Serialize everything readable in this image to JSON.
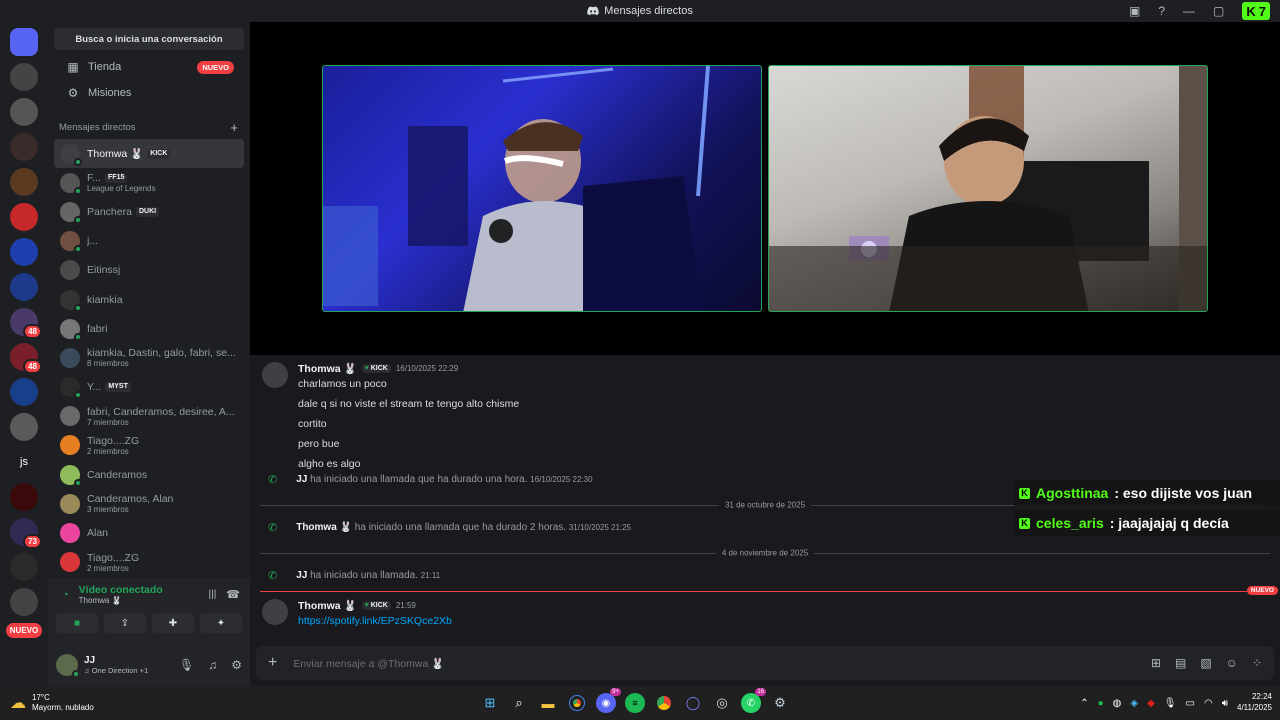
{
  "window": {
    "title": "Mensajes directos",
    "kick_badge": "7"
  },
  "rail": {
    "servers": [
      {
        "label": "",
        "color": "#5865f2",
        "badge": ""
      },
      {
        "label": "",
        "color": "#444",
        "badge": ""
      },
      {
        "label": "",
        "color": "#555",
        "badge": ""
      },
      {
        "label": "",
        "color": "#3b2a2a",
        "badge": ""
      },
      {
        "label": "",
        "color": "#5a3a20",
        "badge": ""
      },
      {
        "label": "",
        "color": "#c62828",
        "badge": ""
      },
      {
        "label": "",
        "color": "#1e40af",
        "badge": ""
      },
      {
        "label": "",
        "color": "#1d3a8a",
        "badge": ""
      },
      {
        "label": "",
        "color": "#4a3a6a",
        "badge": "48"
      },
      {
        "label": "",
        "color": "#7a1f2a",
        "badge": "48"
      },
      {
        "label": "",
        "color": "#1a3f8a",
        "badge": ""
      },
      {
        "label": "",
        "color": "#5a5a5a",
        "badge": ""
      },
      {
        "label": "js",
        "color": "#1e1f22",
        "badge": ""
      },
      {
        "label": "",
        "color": "#3a0a0a",
        "badge": ""
      },
      {
        "label": "",
        "color": "#302a55",
        "badge": "73"
      },
      {
        "label": "",
        "color": "#2a2a2a",
        "badge": ""
      },
      {
        "label": "",
        "color": "#444",
        "badge": ""
      }
    ],
    "new_label": "NUEVO"
  },
  "sidebar": {
    "search_label": "Busca o inicia una conversación",
    "nav": [
      {
        "label": "Tienda",
        "badge": "NUEVO"
      },
      {
        "label": "Misiones",
        "badge": ""
      }
    ],
    "dm_header": "Mensajes directos",
    "dms": [
      {
        "name": "Thomwa 🐰",
        "tag": "KICK",
        "sub": "",
        "color": "#3f3f46",
        "status": "#23a55a",
        "active": true
      },
      {
        "name": "F...",
        "tag": "FF15",
        "sub": "League of Legends",
        "color": "#555",
        "status": "#23a55a",
        "active": false
      },
      {
        "name": "Panchera",
        "tag": "DUKI",
        "sub": "",
        "color": "#666",
        "status": "#23a55a",
        "active": false
      },
      {
        "name": "j...",
        "tag": "",
        "sub": "",
        "color": "#705040",
        "status": "#23a55a",
        "active": false
      },
      {
        "name": "Eitinssj",
        "tag": "",
        "sub": "",
        "color": "#4a4a4a",
        "status": "",
        "active": false
      },
      {
        "name": "kiamkia",
        "tag": "",
        "sub": "",
        "color": "#333",
        "status": "#23a55a",
        "active": false
      },
      {
        "name": "fabri",
        "tag": "",
        "sub": "",
        "color": "#777",
        "status": "#23a55a",
        "active": false
      },
      {
        "name": "kiamkia, Dastin, galo, fabri, se...",
        "tag": "",
        "sub": "8 miembros",
        "color": "#3a4a5a",
        "status": "",
        "active": false
      },
      {
        "name": "Y...",
        "tag": "MYST",
        "sub": "",
        "color": "#2a2a2a",
        "status": "#23a55a",
        "active": false
      },
      {
        "name": "fabri, Canderamos, desiree, A...",
        "tag": "",
        "sub": "7 miembros",
        "color": "#6a6a6a",
        "status": "",
        "active": false
      },
      {
        "name": "Tiago....ZG",
        "tag": "",
        "sub": "2 miembros",
        "color": "#e67e22",
        "status": "",
        "active": false
      },
      {
        "name": "Canderamos",
        "tag": "",
        "sub": "",
        "color": "#8fbc5a",
        "status": "#23a55a",
        "active": false
      },
      {
        "name": "Canderamos, Alan",
        "tag": "",
        "sub": "3 miembros",
        "color": "#9a8a5a",
        "status": "",
        "active": false
      },
      {
        "name": "Alan",
        "tag": "",
        "sub": "",
        "color": "#eb459e",
        "status": "",
        "active": false
      },
      {
        "name": "Tiago....ZG",
        "tag": "",
        "sub": "2 miembros",
        "color": "#da373c",
        "status": "",
        "active": false
      }
    ]
  },
  "voice": {
    "title": "Vídeo conectado",
    "sub": "Thomwa 🐰"
  },
  "user": {
    "name": "JJ",
    "activity": "One Direction +1"
  },
  "messages": {
    "first": {
      "author": "Thomwa 🐰",
      "tag": "KICK",
      "time": "16/10/2025 22:29",
      "lines": [
        "charlamos un poco",
        "dale q si no viste el stream te tengo alto chisme",
        "cortito",
        "pero bue",
        "algho es algo"
      ]
    },
    "sys1": {
      "who": "JJ",
      "text": "ha iniciado una llamada que ha durado una hora.",
      "time": "16/10/2025 22:30"
    },
    "div1": "31 de octubre de 2025",
    "sys2": {
      "who": "Thomwa 🐰",
      "text": "ha iniciado una llamada que ha durado 2 horas.",
      "time": "31/10/2025 21:25"
    },
    "div2": "4 de noviembre de 2025",
    "sys3": {
      "who": "JJ",
      "text": "ha iniciado una llamada.",
      "time": "21:11"
    },
    "new_label": "NUEVO",
    "last": {
      "author": "Thomwa 🐰",
      "tag": "KICK",
      "time": "21:59",
      "link": "https://spotify.link/EPzSKQce2Xb"
    }
  },
  "composer": {
    "placeholder": "Enviar mensaje a @Thomwa 🐰"
  },
  "kick_chat": [
    {
      "user": "Agosttinaa",
      "text": ": eso dijiste vos juan"
    },
    {
      "user": "celes_aris",
      "text": ": jaajajajaj q decía"
    }
  ],
  "taskbar": {
    "temp": "17°C",
    "weather": "Mayorm. nublado",
    "time": "22:24",
    "date": "4/11/2025",
    "discord_badge": "9+",
    "whatsapp_badge": "16"
  }
}
